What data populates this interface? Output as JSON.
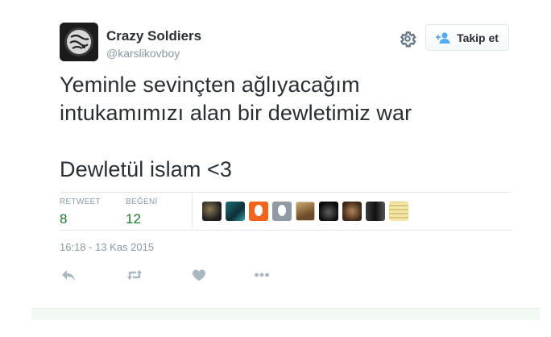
{
  "user": {
    "display_name": "Crazy Soldiers",
    "screen_name": "@karslikovboy",
    "avatar_icon": "profile-avatar"
  },
  "follow_button": {
    "label": "Takip et",
    "icon": "follow-person-plus-icon"
  },
  "tweet": {
    "text": "Yeminle sevinçten ağlıyacağım\nintukamımızı alan bir dewletimiz war\n\nDewletül islam <3"
  },
  "stats": {
    "retweets": {
      "label": "RETWEET",
      "value": "8"
    },
    "likes": {
      "label": "BEĞENİ",
      "value": "12"
    }
  },
  "likers_count_shown": 9,
  "timestamp": "16:18 - 13 Kas 2015",
  "actions": {
    "reply": "reply-icon",
    "retweet": "retweet-icon",
    "like": "heart-icon",
    "more": "more-dots-icon"
  },
  "colors": {
    "stat_value": "#1e7a2e",
    "muted": "#8899a6",
    "icon": "#aab8c2",
    "text": "#292f33"
  }
}
